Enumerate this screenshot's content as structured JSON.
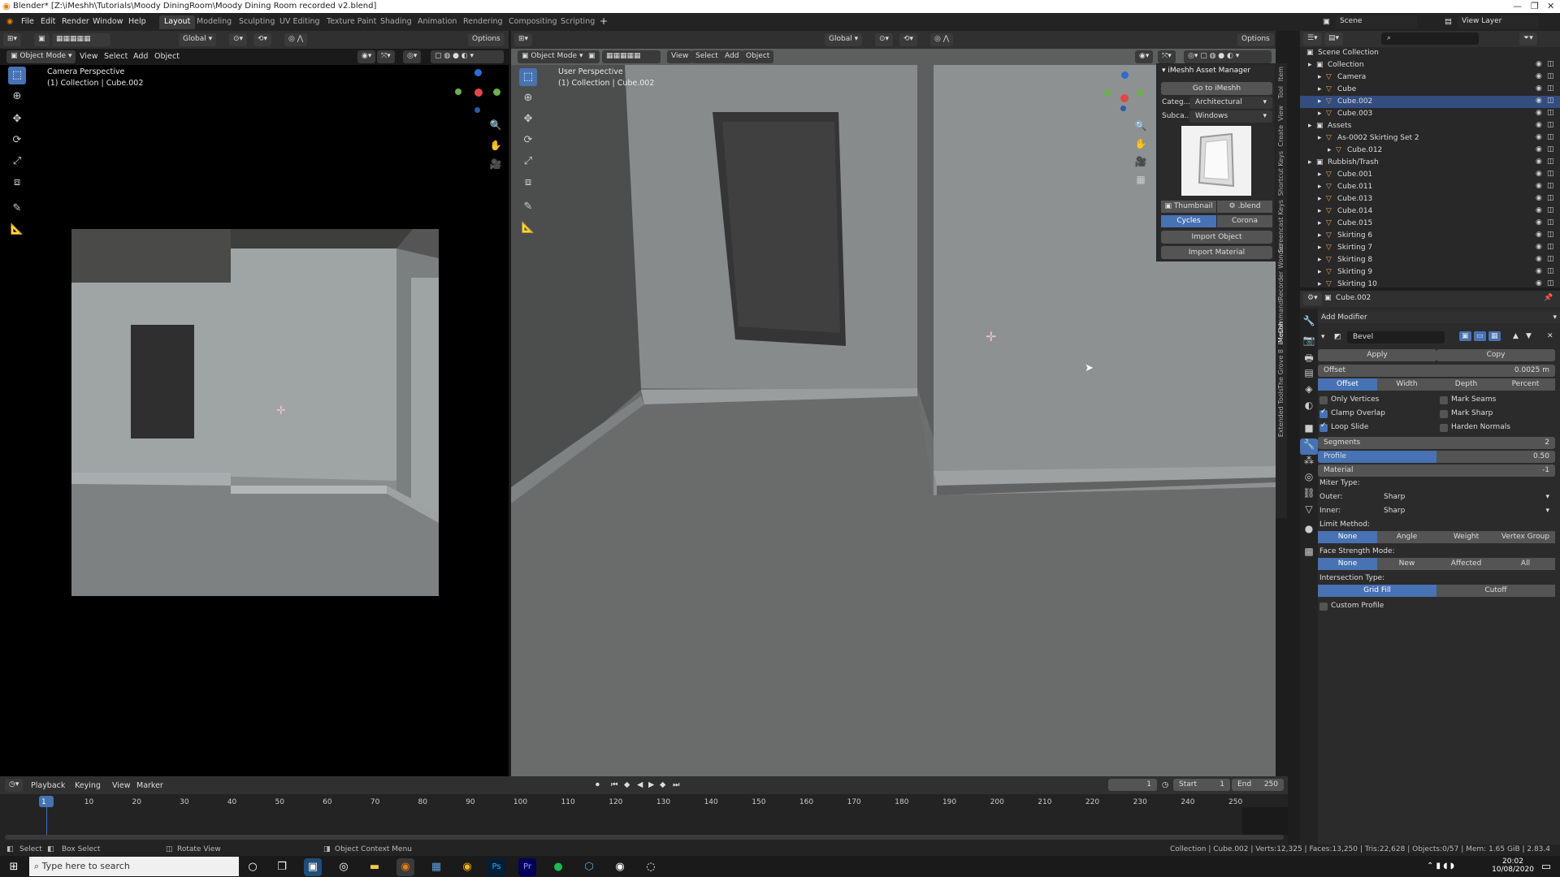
{
  "title": "Blender* [Z:\\iMeshh\\Tutorials\\Moody DiningRoom\\Moody Dining Room recorded v2.blend]",
  "menu": [
    "File",
    "Edit",
    "Render",
    "Window",
    "Help"
  ],
  "workspaces": [
    "Layout",
    "Modeling",
    "Sculpting",
    "UV Editing",
    "Texture Paint",
    "Shading",
    "Animation",
    "Rendering",
    "Compositing",
    "Scripting"
  ],
  "scene": "Scene",
  "view_layer": "View Layer",
  "left_vp": {
    "mode": "Object Mode",
    "menus": [
      "View",
      "Select",
      "Add",
      "Object"
    ],
    "transform": "Global",
    "options": "Options",
    "info1": "Camera Perspective",
    "info2": "(1) Collection | Cube.002"
  },
  "right_vp": {
    "mode": "Object Mode",
    "menus": [
      "View",
      "Select",
      "Add",
      "Object"
    ],
    "transform": "Global",
    "options": "Options",
    "info1": "User Perspective",
    "info2": "(1) Collection | Cube.002"
  },
  "imeshh": {
    "header": "iMeshh Asset Manager",
    "goto": "Go to iMeshh",
    "cat_label": "Categ...",
    "cat_value": "Architectural",
    "sub_label": "Subca...",
    "sub_value": "Windows",
    "thumb": "Thumbnail",
    "blend": ".blend",
    "engine1": "Cycles",
    "engine2": "Corona",
    "import_obj": "Import Object",
    "import_mat": "Import Material"
  },
  "sidetabs": [
    "Item",
    "Tool",
    "View",
    "Create",
    "Shortcut Keys",
    "Screencast Keys",
    "Wonder",
    "CommandRecorder",
    "iMeshh",
    "The Grove 8",
    "Extended Tools"
  ],
  "outliner": {
    "root": "Scene Collection",
    "rows": [
      {
        "name": "Collection",
        "indent": 1
      },
      {
        "name": "Camera",
        "indent": 2
      },
      {
        "name": "Cube",
        "indent": 2
      },
      {
        "name": "Cube.002",
        "indent": 2
      },
      {
        "name": "Cube.003",
        "indent": 2
      },
      {
        "name": "Assets",
        "indent": 1
      },
      {
        "name": "As-0002 Skirting Set 2",
        "indent": 2
      },
      {
        "name": "Cube.012",
        "indent": 3
      },
      {
        "name": "Rubbish/Trash",
        "indent": 1
      },
      {
        "name": "Cube.001",
        "indent": 2
      },
      {
        "name": "Cube.011",
        "indent": 2
      },
      {
        "name": "Cube.013",
        "indent": 2
      },
      {
        "name": "Cube.014",
        "indent": 2
      },
      {
        "name": "Cube.015",
        "indent": 2
      },
      {
        "name": "Skirting 6",
        "indent": 2
      },
      {
        "name": "Skirting 7",
        "indent": 2
      },
      {
        "name": "Skirting 8",
        "indent": 2
      },
      {
        "name": "Skirting 9",
        "indent": 2
      },
      {
        "name": "Skirting 10",
        "indent": 2
      }
    ]
  },
  "props": {
    "object": "Cube.002",
    "add_modifier": "Add Modifier",
    "modifier": "Bevel",
    "apply": "Apply",
    "copy": "Copy",
    "offset_label": "Offset",
    "offset_value": "0.0025 m",
    "width_types": [
      "Offset",
      "Width",
      "Depth",
      "Percent"
    ],
    "only_vertices": "Only Vertices",
    "mark_seams": "Mark Seams",
    "clamp_overlap": "Clamp Overlap",
    "mark_sharp": "Mark Sharp",
    "loop_slide": "Loop Slide",
    "harden_normals": "Harden Normals",
    "segments_label": "Segments",
    "segments_value": "2",
    "profile_label": "Profile",
    "profile_value": "0.50",
    "profile_fraction": 0.5,
    "material_label": "Material",
    "material_value": "-1",
    "miter_type": "Miter Type:",
    "outer_label": "Outer:",
    "outer_value": "Sharp",
    "inner_label": "Inner:",
    "inner_value": "Sharp",
    "limit_method": "Limit Method:",
    "limit_opts": [
      "None",
      "Angle",
      "Weight",
      "Vertex Group"
    ],
    "face_strength": "Face Strength Mode:",
    "face_opts": [
      "None",
      "New",
      "Affected",
      "All"
    ],
    "intersection": "Intersection Type:",
    "inter_opts": [
      "Grid Fill",
      "Cutoff"
    ],
    "custom_profile": "Custom Profile"
  },
  "timeline": {
    "menus": [
      "Playback",
      "Keying",
      "View",
      "Marker"
    ],
    "current": "1",
    "start_label": "Start",
    "start": "1",
    "end_label": "End",
    "end": "250",
    "ticks": [
      "1",
      "10",
      "20",
      "30",
      "40",
      "50",
      "60",
      "70",
      "80",
      "90",
      "100",
      "110",
      "120",
      "130",
      "140",
      "150",
      "160",
      "170",
      "180",
      "190",
      "200",
      "210",
      "220",
      "230",
      "240",
      "250"
    ]
  },
  "status": {
    "select": "Select",
    "box": "Box Select",
    "rotate": "Rotate View",
    "context": "Object Context Menu",
    "stats": "Collection | Cube.002 | Verts:12,325 | Faces:13,250 | Tris:22,628 | Objects:0/57 | Mem: 1.65 GiB | 2.83.4"
  },
  "taskbar": {
    "search": "Type here to search",
    "time": "20:02",
    "date": "10/08/2020"
  }
}
